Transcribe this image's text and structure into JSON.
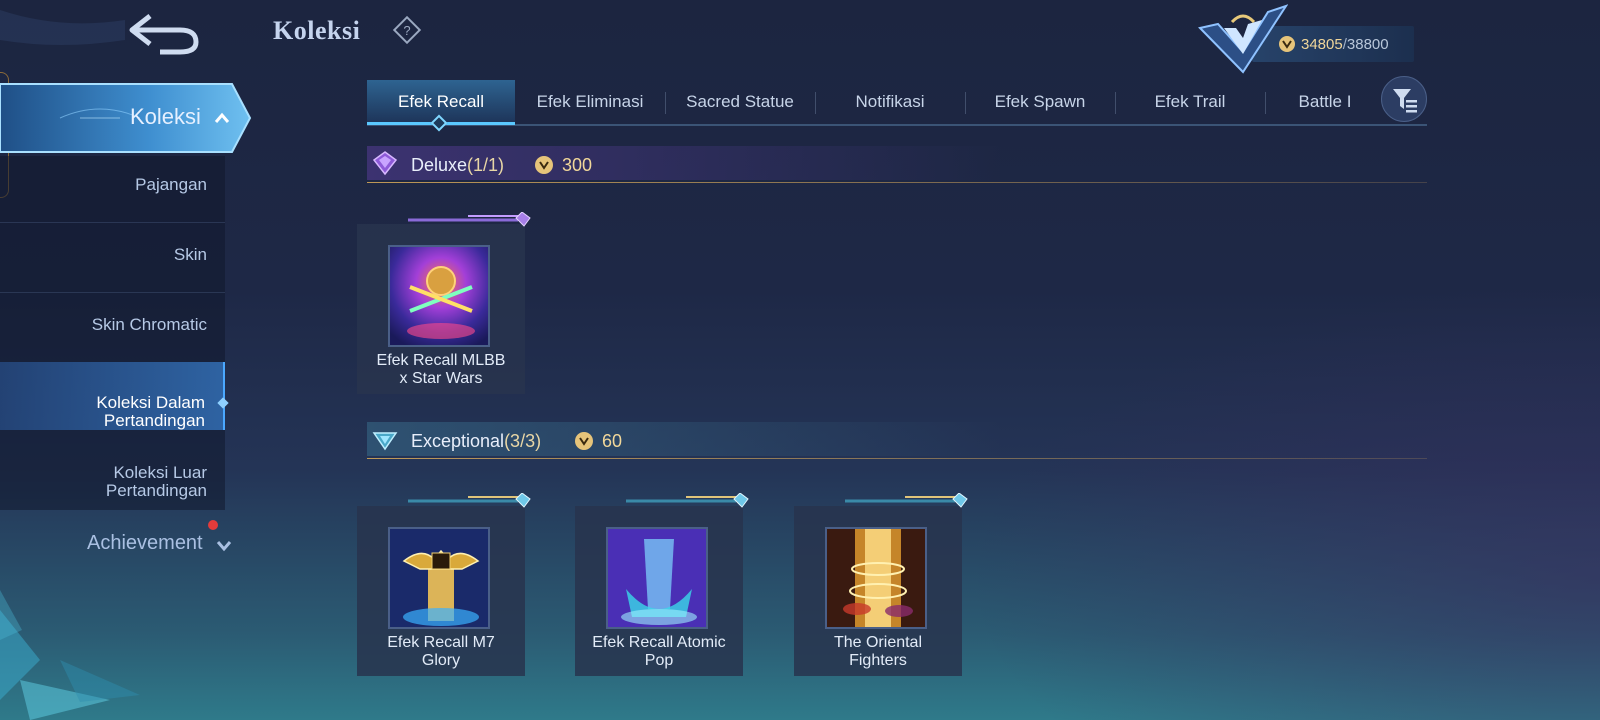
{
  "header": {
    "title": "Koleksi",
    "back_icon": "back-arrow-icon",
    "help_icon": "question-diamond-icon",
    "points_current": "34805",
    "points_separator": "/",
    "points_max": "38800"
  },
  "sidebar": {
    "section_title": "Koleksi",
    "items": [
      {
        "label": "Pajangan"
      },
      {
        "label": "Skin"
      },
      {
        "label": "Skin Chromatic"
      },
      {
        "label": "Koleksi Dalam\nPertandingan",
        "active": true
      },
      {
        "label": "Koleksi Luar\nPertandingan"
      }
    ],
    "achievement_label": "Achievement"
  },
  "tabs": [
    {
      "label": "Efek Recall",
      "active": true
    },
    {
      "label": "Efek Eliminasi"
    },
    {
      "label": "Sacred Statue"
    },
    {
      "label": "Notifikasi"
    },
    {
      "label": "Efek Spawn"
    },
    {
      "label": "Efek Trail"
    },
    {
      "label": "Battle I"
    }
  ],
  "sections": {
    "deluxe": {
      "title": "Deluxe",
      "count": "(1/1)",
      "cost": "300",
      "items": [
        {
          "name": "Efek Recall MLBB\nx Star Wars"
        }
      ]
    },
    "exceptional": {
      "title": "Exceptional",
      "count": "(3/3)",
      "cost": "60",
      "items": [
        {
          "name": "Efek Recall M7\nGlory"
        },
        {
          "name": "Efek Recall Atomic\nPop"
        },
        {
          "name": "The Oriental\nFighters"
        }
      ]
    }
  },
  "colors": {
    "accent": "#5ac8ff",
    "gold": "#f1d79a",
    "badge_red": "#e23b3b"
  }
}
